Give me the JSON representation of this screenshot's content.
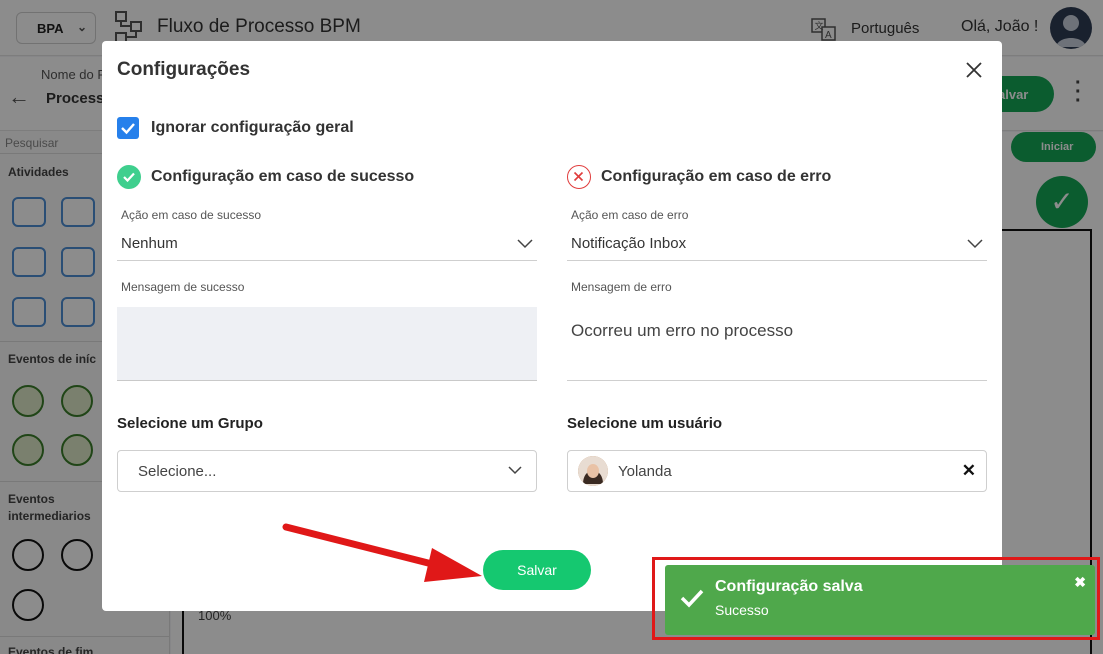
{
  "topbar": {
    "app_select": "BPA",
    "title": "Fluxo de Processo BPM",
    "language": "Português",
    "greeting": "Olá, João !"
  },
  "subbar": {
    "name_label": "Nome do P",
    "name_value": "Process",
    "save_label": "alvar"
  },
  "sidebar": {
    "search": "Pesquisar",
    "activities_title": "Atividades",
    "start_events_title": "Eventos de iníc",
    "intermediate_events_title": "Eventos intermediarios",
    "end_events_title": "Eventos de fim"
  },
  "canvas": {
    "start_label": "Iniciar",
    "zoom": "100%"
  },
  "modal": {
    "title": "Configurações",
    "ignore_general": "Ignorar configuração geral",
    "ignore_general_checked": true,
    "success": {
      "title": "Configuração em caso de sucesso",
      "action_label": "Ação em caso de sucesso",
      "action_value": "Nenhum",
      "message_label": "Mensagem de sucesso",
      "message_value": ""
    },
    "error": {
      "title": "Configuração em caso de erro",
      "action_label": "Ação em caso de erro",
      "action_value": "Notificação Inbox",
      "message_label": "Mensagem de erro",
      "message_value": "Ocorreu um erro no processo"
    },
    "group": {
      "label": "Selecione um Grupo",
      "placeholder": "Selecione..."
    },
    "user": {
      "label": "Selecione um usuário",
      "value": "Yolanda"
    },
    "save_label": "Salvar"
  },
  "toast": {
    "title": "Configuração salva",
    "message": "Sucesso",
    "close": "✖"
  },
  "colors": {
    "primary_green": "#15c870",
    "toast_green": "#4fa84b",
    "checkbox_blue": "#2680eb",
    "error_red": "#e03c3c",
    "annotation_red": "#e01818"
  }
}
